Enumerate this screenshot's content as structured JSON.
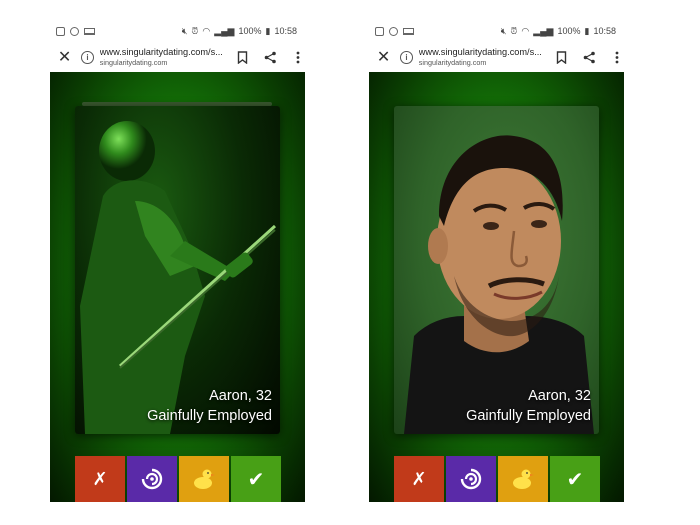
{
  "screens": [
    {
      "status": {
        "battery": "100%",
        "time": "10:58"
      },
      "browser": {
        "url": "www.singularitydating.com/s...",
        "domain": "singularitydating.com"
      },
      "card": {
        "name_age": "Aaron, 32",
        "tagline": "Gainfully Employed"
      },
      "actions": {
        "reject": "✗",
        "accept": "✔"
      }
    },
    {
      "status": {
        "battery": "100%",
        "time": "10:58"
      },
      "browser": {
        "url": "www.singularitydating.com/s...",
        "domain": "singularitydating.com"
      },
      "card": {
        "name_age": "Aaron, 32",
        "tagline": "Gainfully Employed"
      },
      "actions": {
        "reject": "✗",
        "accept": "✔"
      }
    }
  ],
  "colors": {
    "reject": "#c13a1a",
    "superlike": "#5a2aa8",
    "duck": "#e0a010",
    "accept": "#48a016",
    "background_green": "#157a08"
  },
  "icons": {
    "reject": "cross-icon",
    "superlike": "swirl-icon",
    "duck": "rubber-duck-icon",
    "accept": "checkmark-icon"
  }
}
